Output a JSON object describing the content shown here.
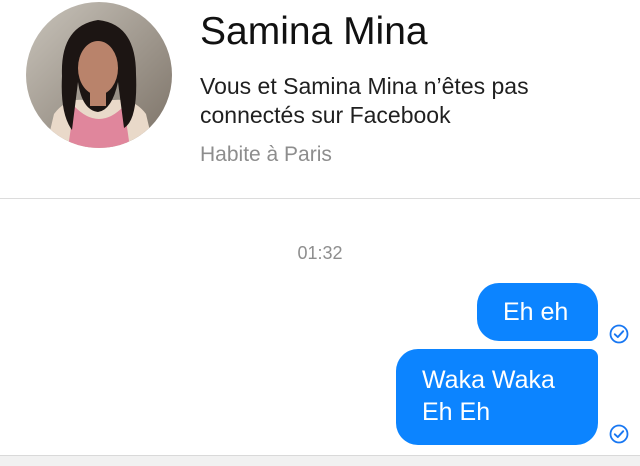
{
  "profile": {
    "name": "Samina Mina",
    "connection_text": "Vous et Samina Mina n’êtes pas connectés sur Facebook",
    "location": "Habite à Paris"
  },
  "thread": {
    "timestamp": "01:32",
    "messages": [
      {
        "lines": [
          "Eh eh"
        ],
        "status_icon": "read-check-icon"
      },
      {
        "lines": [
          "Waka Waka",
          "Eh Eh"
        ],
        "status_icon": "read-check-icon"
      }
    ]
  },
  "colors": {
    "bubble": "#0c84ff",
    "status_check": "#1877f2"
  }
}
